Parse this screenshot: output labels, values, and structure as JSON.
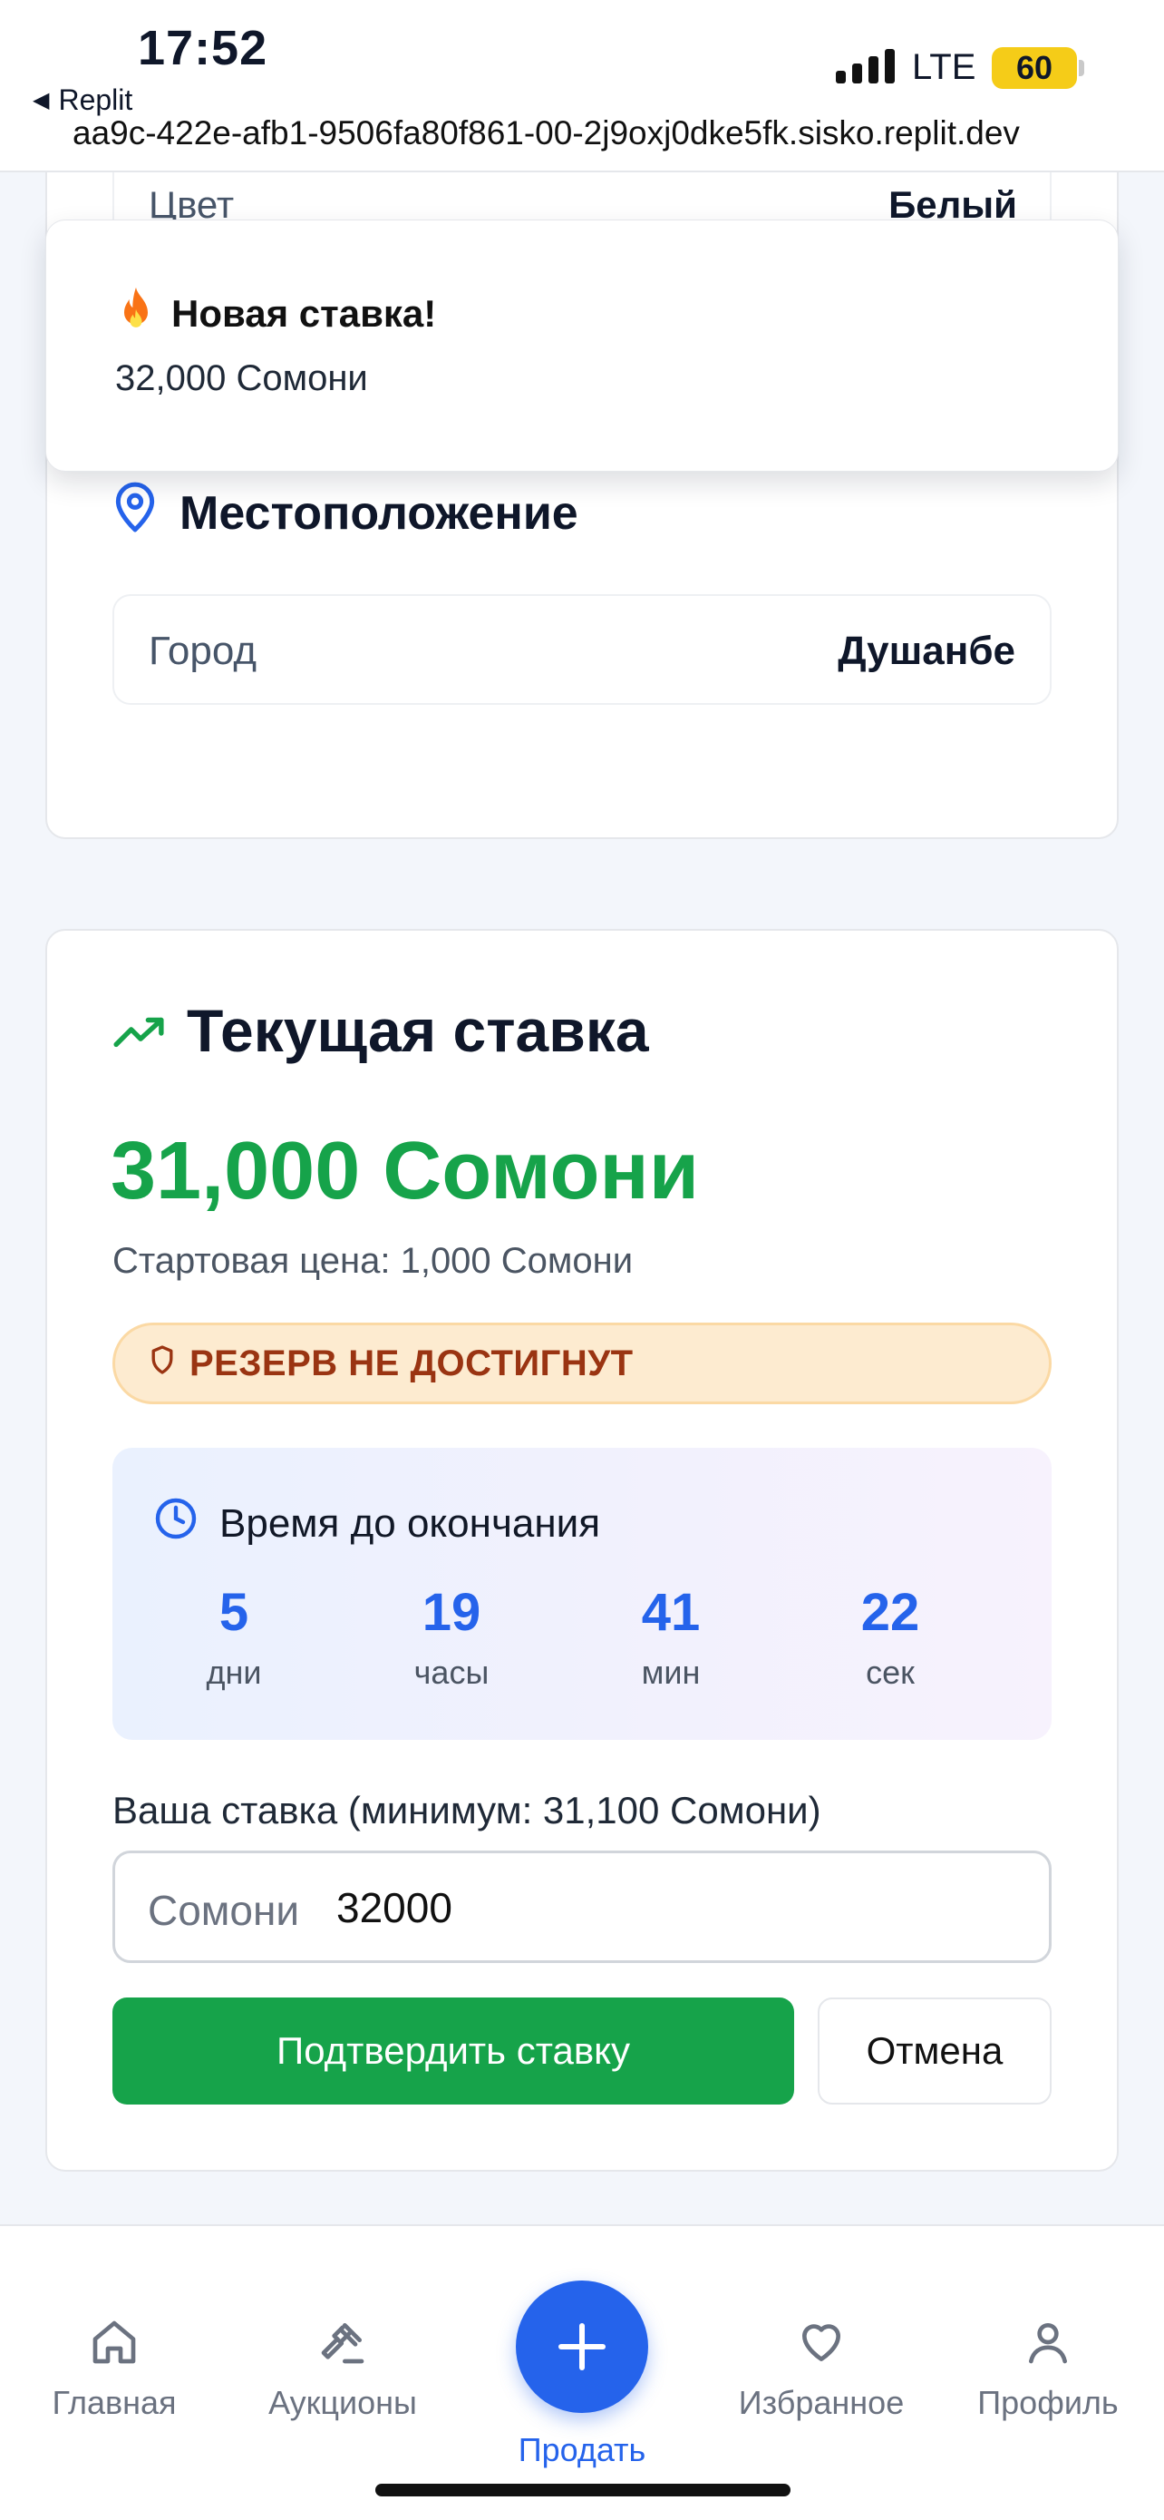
{
  "status_bar": {
    "time": "17:52",
    "back_app": "Replit",
    "url": "aa9c-422e-afb1-9506fa80f861-00-2j9oxj0dke5fk.sisko.replit.dev",
    "network": "LTE",
    "battery": "60"
  },
  "specs": {
    "color_label": "Цвет",
    "color_value": "Белый"
  },
  "toast": {
    "icon": "fire-icon",
    "title": "Новая ставка!",
    "description": "32,000 Сомони"
  },
  "location": {
    "title": "Местоположение",
    "city_label": "Город",
    "city_value": "Душанбе"
  },
  "bid": {
    "title": "Текущая ставка",
    "current_price": "31,000 Сомони",
    "start_price": "Стартовая цена: 1,000 Сомони",
    "reserve_badge": "РЕЗЕРВ НЕ ДОСТИГНУТ",
    "timer": {
      "title": "Время до окончания",
      "units": [
        {
          "value": "5",
          "label": "дни"
        },
        {
          "value": "19",
          "label": "часы"
        },
        {
          "value": "41",
          "label": "мин"
        },
        {
          "value": "22",
          "label": "сек"
        }
      ]
    },
    "input_label": "Ваша ставка (минимум: 31,100 Сомони)",
    "input_prefix": "Сомони",
    "input_value": "32000",
    "confirm_label": "Подтвердить ставку",
    "cancel_label": "Отмена"
  },
  "colors": {
    "accent_green": "#16a34a",
    "accent_blue": "#2563eb",
    "reserve_text": "#9a3412"
  },
  "bottom_nav": {
    "items": [
      {
        "label": "Главная",
        "icon": "home-icon"
      },
      {
        "label": "Аукционы",
        "icon": "gavel-icon"
      },
      {
        "label": "Продать",
        "icon": "plus-icon"
      },
      {
        "label": "Избранное",
        "icon": "heart-icon"
      },
      {
        "label": "Профиль",
        "icon": "user-icon"
      }
    ]
  }
}
